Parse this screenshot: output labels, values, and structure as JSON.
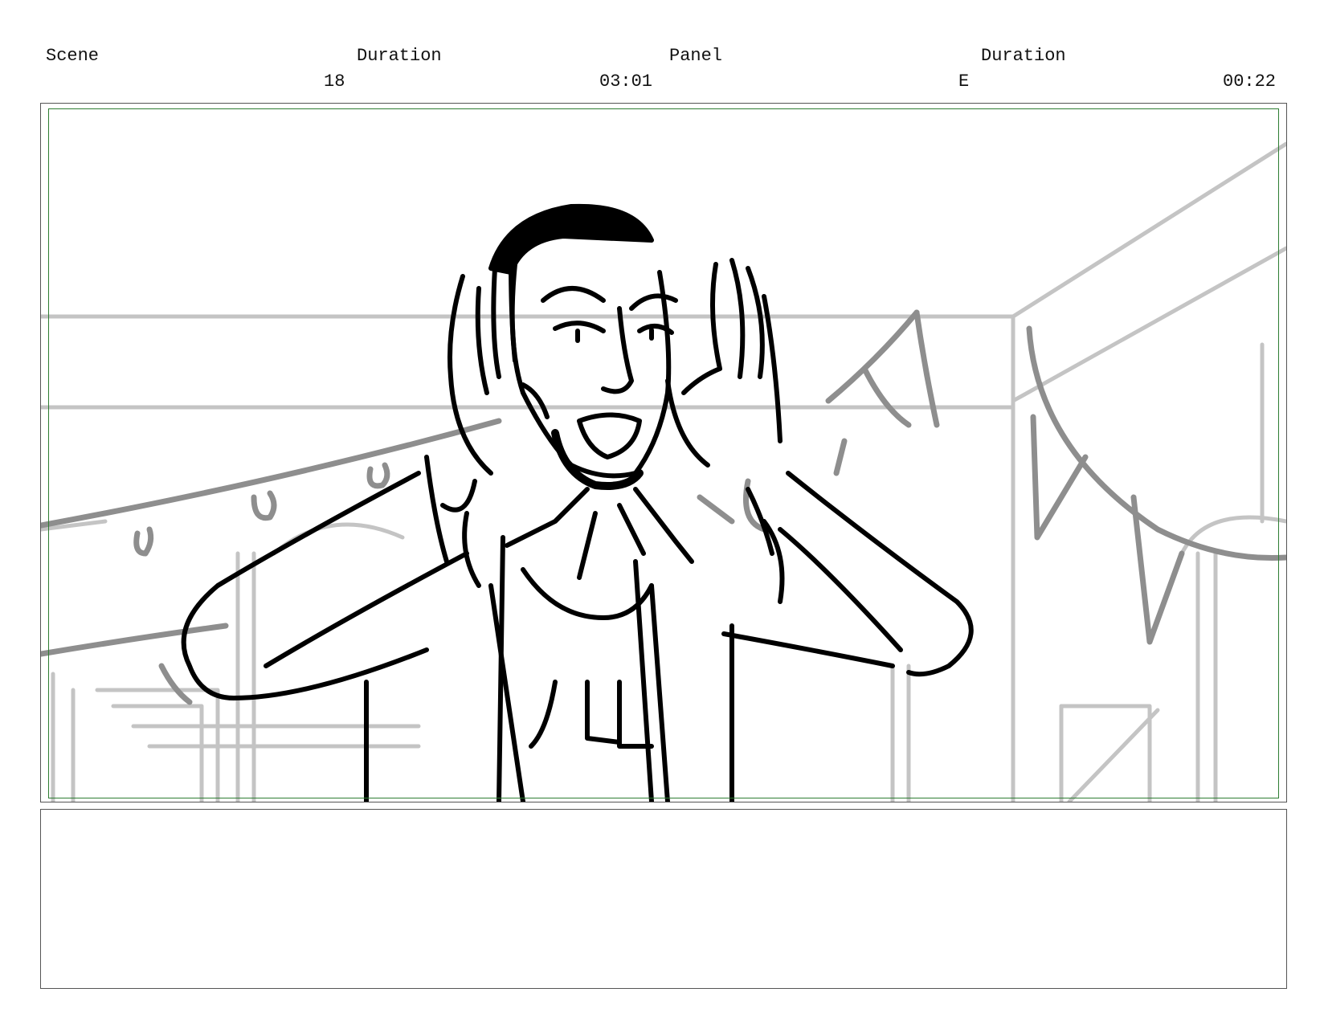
{
  "header": {
    "scene_label": "Scene",
    "scene_duration_label": "Duration",
    "panel_label": "Panel",
    "panel_duration_label": "Duration",
    "scene_value": "18",
    "scene_duration_value": "03:01",
    "panel_value": "E",
    "panel_duration_value": "00:22"
  },
  "colors": {
    "safe_area_border": "#2e7d32",
    "sketch_ink": "#000000",
    "background_sketch": "#bdbdbd",
    "midground_sketch": "#8a8a8a"
  },
  "notes": {
    "text": ""
  }
}
